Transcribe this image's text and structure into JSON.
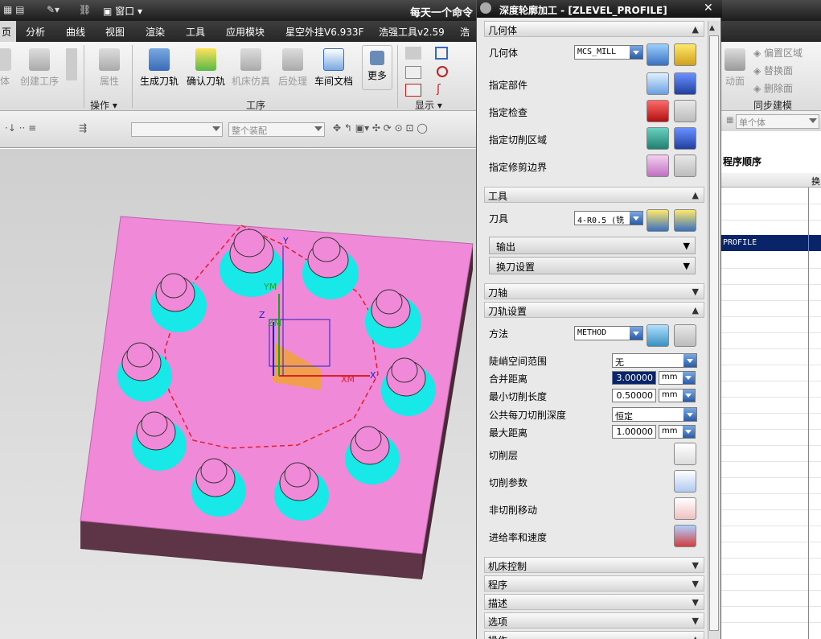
{
  "titlebar": {
    "window_menu": "窗口",
    "app_title": "每天一个命令"
  },
  "menubar": {
    "items": [
      "页",
      "分析",
      "曲线",
      "视图",
      "渲染",
      "工具",
      "应用模块",
      "星空外挂V6.933F",
      "浩强工具v2.59",
      "浩"
    ]
  },
  "ribbon": {
    "buttons": {
      "body": "体",
      "create_program": "创建工序",
      "properties": "属性",
      "generate_toolpath": "生成刀轨",
      "verify_toolpath": "确认刀轨",
      "machine_sim": "机床仿真",
      "postprocess": "后处理",
      "shop_doc": "车间文档",
      "more": "更多"
    },
    "groups": {
      "operation": "操作",
      "process": "工序",
      "display": "显示",
      "sync_modeling": "同步建模"
    },
    "right_buttons": {
      "move_face": "动面",
      "offset_region": "偏置区域",
      "replace_face": "替换面",
      "delete_face": "删除面"
    }
  },
  "toolbar": {
    "assembly_filter": "整个装配",
    "single_body": "单个体"
  },
  "navigator": {
    "header": "程序顺序",
    "col2": "换",
    "selected_row": "PROFILE"
  },
  "graphics": {
    "axis_xm": "XM",
    "axis_ym": "YM",
    "axis_zm": "ZM",
    "axis_x": "X",
    "axis_y": "Y",
    "axis_z": "Z"
  },
  "dialog": {
    "title": "深度轮廓加工 - [ZLEVEL_PROFILE]",
    "close": "✕",
    "sections": {
      "geometry": "几何体",
      "tool": "工具",
      "tool_axis": "刀轴",
      "path_settings": "刀轨设置",
      "machine_control": "机床控制",
      "program": "程序",
      "description": "描述",
      "options": "选项",
      "actions": "操作"
    },
    "geometry": {
      "geometry_label": "几何体",
      "geometry_value": "MCS_MILL",
      "specify_part": "指定部件",
      "specify_check": "指定检查",
      "specify_cut_area": "指定切削区域",
      "specify_trim": "指定修剪边界"
    },
    "tool": {
      "tool_label": "刀具",
      "tool_value": "4-R0.5 (铣",
      "output": "输出",
      "tool_change": "换刀设置"
    },
    "path": {
      "method_label": "方法",
      "method_value": "METHOD",
      "steep_label": "陡峭空间范围",
      "steep_value": "无",
      "merge_label": "合并距离",
      "merge_value": "3.00000",
      "min_cut_label": "最小切削长度",
      "min_cut_value": "0.50000",
      "depth_label": "公共每刀切削深度",
      "depth_value": "恒定",
      "max_dist_label": "最大距离",
      "max_dist_value": "1.00000",
      "unit": "mm",
      "cut_levels": "切削层",
      "cut_params": "切削参数",
      "non_cut": "非切削移动",
      "feeds": "进给率和速度"
    }
  },
  "colors": {
    "block_top": "#f08ad8",
    "block_side": "#6a3a4c",
    "boss": "#18e8e8",
    "toolpath": "#e0202a",
    "accent": "#2a5ba8"
  }
}
